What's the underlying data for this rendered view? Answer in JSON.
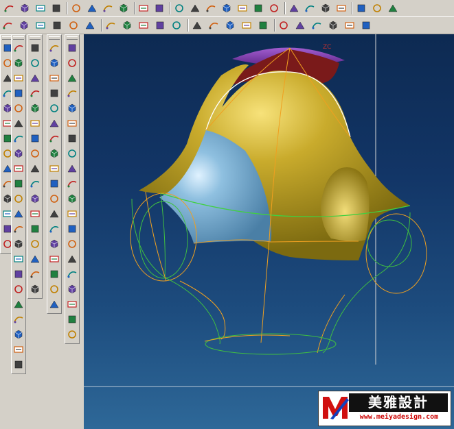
{
  "toolbar_row1": {
    "icons": [
      "new-icon",
      "open-icon",
      "save-icon",
      "print-icon",
      "cut-icon",
      "copy-icon",
      "paste-icon",
      "delete-icon",
      "undo-icon",
      "edit-icon",
      "fit-all-icon",
      "zoom-window-icon",
      "zoom-area-icon",
      "zoom-icon",
      "rotate-icon",
      "pan-icon",
      "view-3d-icon",
      "view-orient-icon",
      "display-mode-icon",
      "render-icon",
      "shade-icon",
      "layer-icon",
      "properties-icon",
      "help-icon"
    ]
  },
  "toolbar_row2": {
    "icons": [
      "point-icon",
      "line-icon",
      "polyline-icon",
      "arc-icon",
      "spline-icon",
      "fillet-icon",
      "rectangle-icon",
      "polygon-icon",
      "circle-icon",
      "ellipse-icon",
      "offset-curve-icon",
      "trim-icon",
      "extend-icon",
      "mirror-icon",
      "pattern-icon",
      "project-icon",
      "intersect-icon",
      "bridge-icon",
      "blend-icon",
      "surface-icon",
      "solid-icon",
      "analysis-icon"
    ]
  },
  "viewport": {
    "axis_label": "ZC",
    "background_top": "#0d2a52",
    "background_bottom": "#2e6898",
    "colors": {
      "canopy": "#b49a20",
      "front_panel": "#6fa5c8",
      "dome": "#7a3aa8",
      "inner_red": "#8a1e1e",
      "orange_curves": "#f0a020",
      "green_curves": "#40c040"
    }
  },
  "watermark": {
    "title": "美雅設計",
    "url": "www.meiyadesign.com"
  }
}
